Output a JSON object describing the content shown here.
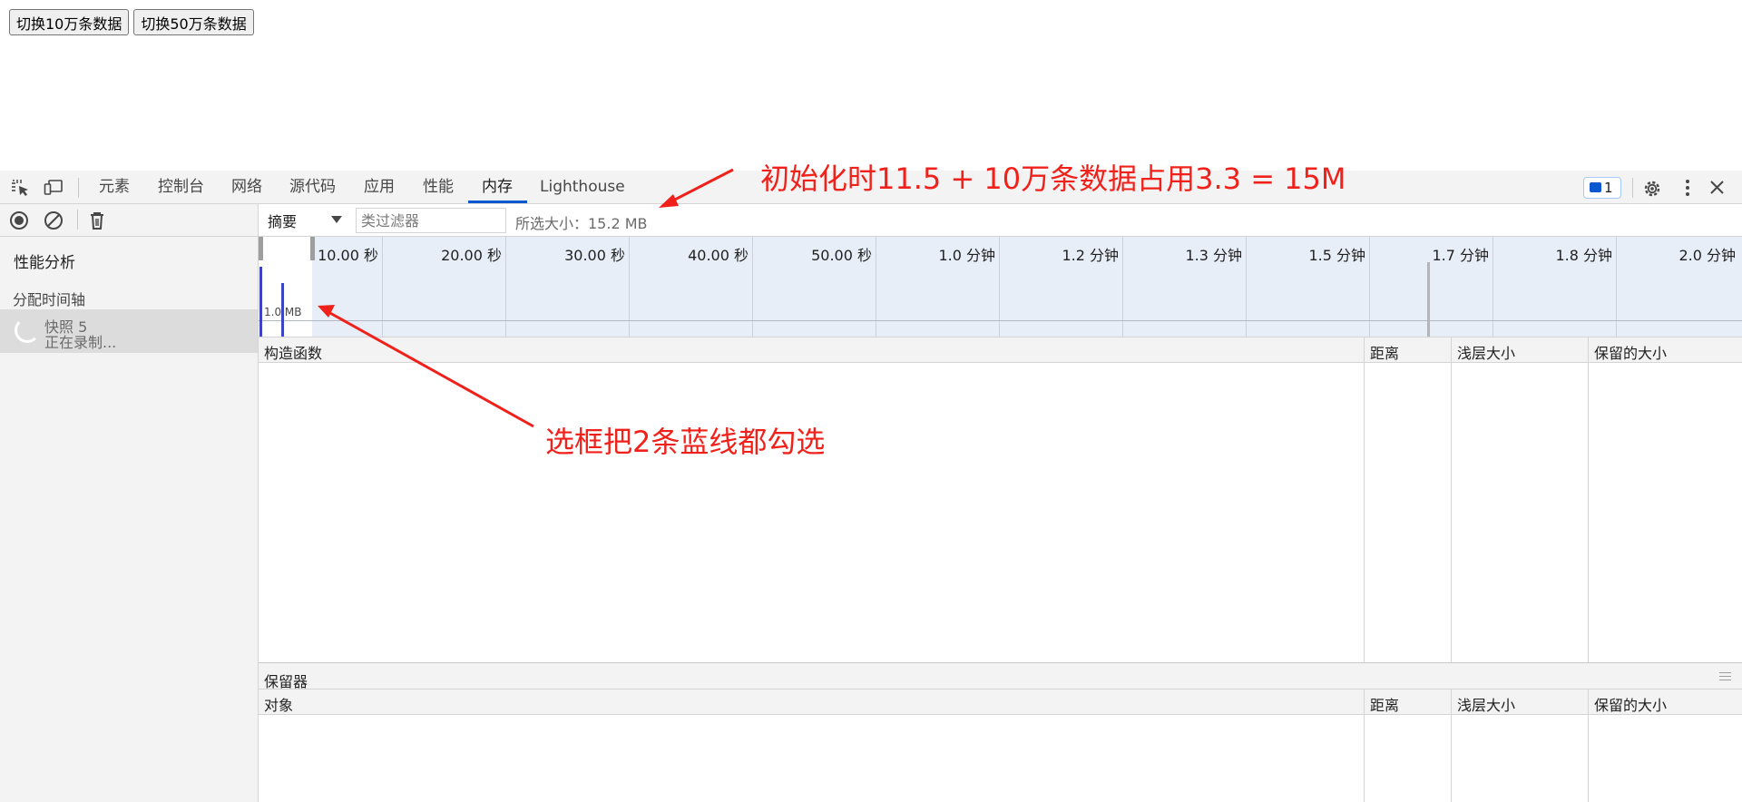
{
  "page": {
    "buttons": [
      "切换10万条数据",
      "切换50万条数据"
    ]
  },
  "devtools": {
    "tabs": [
      "元素",
      "控制台",
      "网络",
      "源代码",
      "应用",
      "性能",
      "内存",
      "Lighthouse"
    ],
    "active_tab": "内存",
    "issues_count": "1",
    "accent_color": "#0b57d0"
  },
  "left_panel": {
    "heading": "性能分析",
    "subheading": "分配时间轴",
    "snapshot_title": "快照 5",
    "snapshot_status": "正在录制..."
  },
  "right_toolbar": {
    "view": "摘要",
    "filter_placeholder": "类过滤器",
    "selected_size": "所选大小：15.2 MB"
  },
  "timeline": {
    "labels": [
      "10.00 秒",
      "20.00 秒",
      "30.00 秒",
      "40.00 秒",
      "50.00 秒",
      "1.0 分钟",
      "1.2 分钟",
      "1.3 分钟",
      "1.5 分钟",
      "1.7 分钟",
      "1.8 分钟",
      "2.0 分钟"
    ],
    "scale_label": "1.0 MB",
    "bar_color": "#3b45c4"
  },
  "constructors_grid": {
    "columns": [
      "构造函数",
      "距离",
      "浅层大小",
      "保留的大小"
    ]
  },
  "retainers": {
    "title": "保留器",
    "columns": [
      "对象",
      "距离",
      "浅层大小",
      "保留的大小"
    ]
  },
  "annotations": {
    "top": "初始化时11.5 + 10万条数据占用3.3 = 15M",
    "middle": "选框把2条蓝线都勾选",
    "color": "#f0211b"
  }
}
